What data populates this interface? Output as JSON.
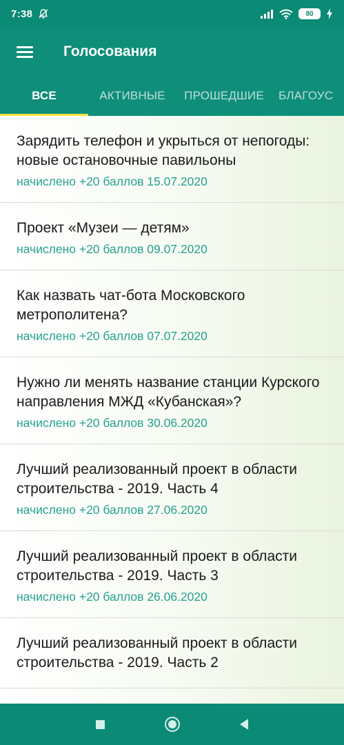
{
  "status_bar": {
    "time": "7:38",
    "battery": "80"
  },
  "app_bar": {
    "title": "Голосования"
  },
  "tabs": [
    {
      "label": "ВСЕ",
      "active": true
    },
    {
      "label": "АКТИВНЫЕ",
      "active": false
    },
    {
      "label": "ПРОШЕДШИЕ",
      "active": false
    },
    {
      "label": "БЛАГОУС",
      "active": false
    }
  ],
  "polls": [
    {
      "title": "Зарядить телефон и укрыться от непогоды: новые остановочные павильоны",
      "meta": "начислено +20 баллов 15.07.2020"
    },
    {
      "title": "Проект «Музеи — детям»",
      "meta": "начислено +20 баллов 09.07.2020"
    },
    {
      "title": "Как назвать чат-бота Московского метрополитена?",
      "meta": "начислено +20 баллов 07.07.2020"
    },
    {
      "title": "Нужно ли менять название станции Курского направления МЖД «Кубанская»?",
      "meta": "начислено +20 баллов 30.06.2020"
    },
    {
      "title": "Лучший реализованный проект в области строительства - 2019. Часть 4",
      "meta": "начислено +20 баллов 27.06.2020"
    },
    {
      "title": "Лучший реализованный проект в области строительства - 2019. Часть 3",
      "meta": "начислено +20 баллов 26.06.2020"
    },
    {
      "title": "Лучший реализованный проект в области строительства - 2019. Часть 2",
      "meta": ""
    }
  ],
  "colors": {
    "primary": "#0f8e79",
    "accent_indicator": "#f6e23b",
    "meta_text": "#27a190"
  },
  "icons": {
    "menu": "hamburger-icon",
    "silent": "bell-off-icon",
    "signal": "signal-icon",
    "wifi": "wifi-icon",
    "charging": "bolt-icon"
  }
}
